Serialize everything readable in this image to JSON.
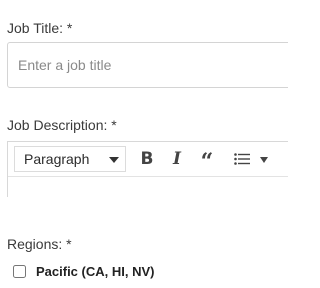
{
  "job_title": {
    "label": "Job Title:",
    "required_mark": "*",
    "placeholder": "Enter a job title",
    "value": ""
  },
  "job_description": {
    "label": "Job Description:",
    "required_mark": "*",
    "toolbar": {
      "heading_select_value": "Paragraph",
      "bold_glyph": "B",
      "italic_glyph": "I",
      "quote_glyph": "“",
      "icons": [
        "chevron-down-icon",
        "bold-icon",
        "italic-icon",
        "block-quote-icon",
        "bulleted-list-icon",
        "chevron-down-icon"
      ]
    }
  },
  "regions": {
    "label": "Regions:",
    "required_mark": "*",
    "options": [
      {
        "label": "Pacific (CA, HI, NV)",
        "checked": false
      }
    ]
  }
}
